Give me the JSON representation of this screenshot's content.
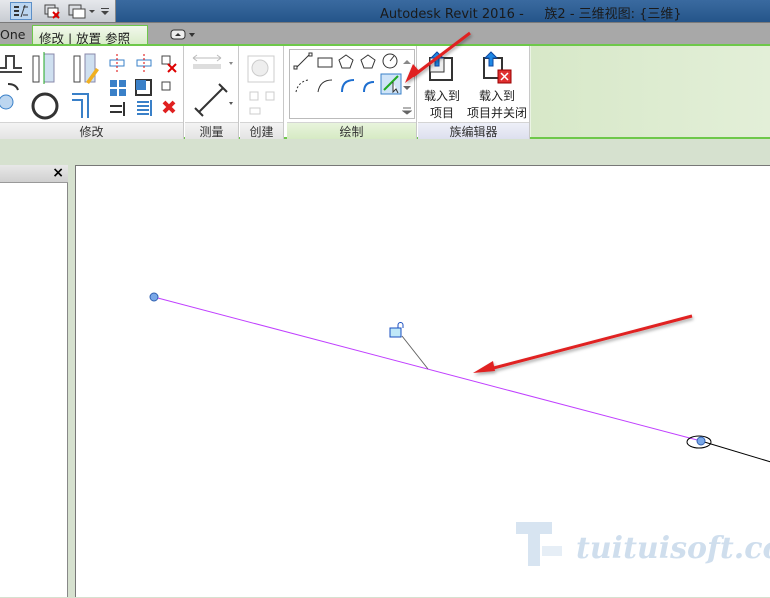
{
  "titlebar": {
    "title": "Autodesk Revit 2016 -     族2 - 三维视图: {三维}"
  },
  "tabs": {
    "partial": "One",
    "active": "修改 | 放置 参照线"
  },
  "panels": {
    "modify": "修改",
    "measure": "测量",
    "create": "创建",
    "draw": "绘制",
    "family_editor": "族编辑器"
  },
  "buttons": {
    "load_project_l1": "载入到",
    "load_project_l2": "项目",
    "load_close_l1": "载入到",
    "load_close_l2": "项目并关闭"
  },
  "left_panel": {
    "close": "×"
  },
  "watermark": "tuituisoft.com",
  "colors": {
    "ref_line": "#c040ff",
    "annotation_arrow": "#e02020",
    "accent": "#6ec84a"
  }
}
